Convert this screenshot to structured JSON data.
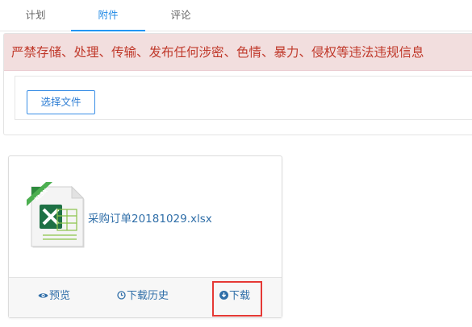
{
  "tabs": [
    {
      "label": "计划",
      "active": false
    },
    {
      "label": "附件",
      "active": true
    },
    {
      "label": "评论",
      "active": false
    }
  ],
  "warning": {
    "text": "严禁存储、处理、传输、发布任何涉密、色情、暴力、侵权等违法违规信息"
  },
  "upload": {
    "select_label": "选择文件"
  },
  "file": {
    "name": "采购订单20181029.xlsx",
    "icon": "xlsx-file-icon",
    "icon_badge": "XLSX"
  },
  "actions": {
    "preview": "预览",
    "history": "下载历史",
    "download": "下载"
  },
  "colors": {
    "accent": "#2196f3",
    "link": "#2f6ea8",
    "warning_bg": "#f2dede",
    "warning_text": "#c0392b",
    "excel_green": "#1e7145",
    "highlight": "#e53935"
  }
}
